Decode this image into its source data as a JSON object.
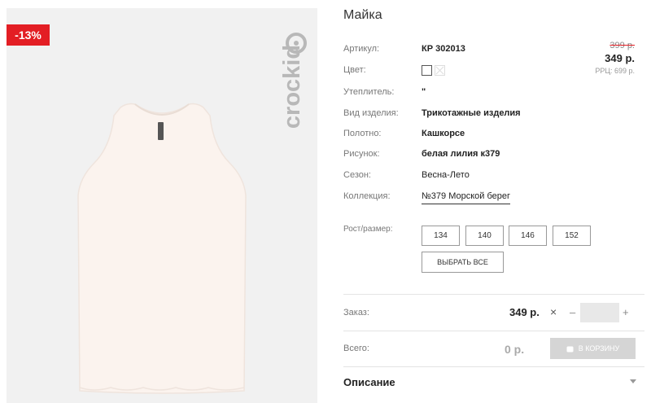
{
  "product_image": {
    "discount_badge": "-13%",
    "brand_text": "crockid"
  },
  "product": {
    "title": "Майка",
    "old_price": "399 р.",
    "price": "349 р.",
    "rrp": "РРЦ: 699 р."
  },
  "specs": [
    {
      "label": "Артикул:",
      "value": "КР 302013"
    },
    {
      "label": "Цвет:",
      "value": ""
    },
    {
      "label": "Утеплитель:",
      "value": "\""
    },
    {
      "label": "Вид изделия:",
      "value": "Трикотажные изделия"
    },
    {
      "label": "Полотно:",
      "value": "Кашкорсе"
    },
    {
      "label": "Рисунок:",
      "value": "белая лилия к379"
    },
    {
      "label": "Сезон:",
      "value": "Весна-Лето"
    },
    {
      "label": "Коллекция:",
      "value": "№379 Морской берег"
    }
  ],
  "colors": {
    "selected": "#ffffff",
    "swatch_border": "#555555"
  },
  "sizes": {
    "label": "Рост/размер:",
    "options": [
      "134",
      "140",
      "146",
      "152"
    ],
    "select_all_label": "ВЫБРАТЬ ВСЕ"
  },
  "order": {
    "label": "Заказ:",
    "unit_price": "349 р.",
    "times_icon": "×",
    "minus": "–",
    "plus": "+",
    "quantity": ""
  },
  "total": {
    "label": "Всего:",
    "value": "0 р.",
    "cart_button_label": "В КОРЗИНУ",
    "cart_icon": "cart-icon"
  },
  "description": {
    "label": "Описание",
    "arrow_icon": "chevron-down-icon"
  },
  "accent_colors": {
    "badge": "#e31e24",
    "cart_button_disabled": "#d5d5d5"
  }
}
